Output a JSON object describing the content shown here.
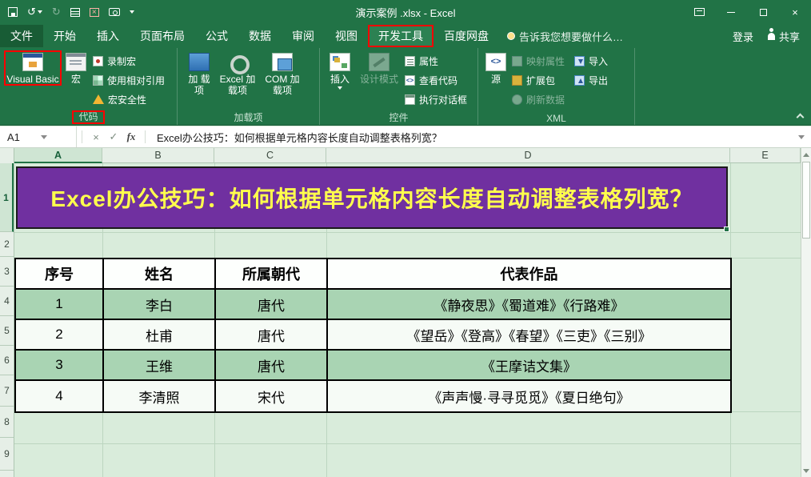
{
  "titlebar": {
    "title": "演示案例 .xlsx - Excel"
  },
  "ribbon": {
    "tabs": [
      {
        "label": "文件",
        "active": false
      },
      {
        "label": "开始",
        "active": false
      },
      {
        "label": "插入",
        "active": false
      },
      {
        "label": "页面布局",
        "active": false
      },
      {
        "label": "公式",
        "active": false
      },
      {
        "label": "数据",
        "active": false
      },
      {
        "label": "审阅",
        "active": false
      },
      {
        "label": "视图",
        "active": false
      },
      {
        "label": "开发工具",
        "active": true
      },
      {
        "label": "百度网盘",
        "active": false
      }
    ],
    "tell_me": "告诉我您想要做什么…",
    "login": "登录",
    "share": "共享",
    "code_group": {
      "label": "代码",
      "visual_basic": "Visual Basic",
      "macros": "宏",
      "record_macro": "录制宏",
      "use_relative_references": "使用相对引用",
      "macro_security": "宏安全性"
    },
    "addins_group": {
      "label": "加载项",
      "addins": "加 载项",
      "excel_addins": "Excel 加载项",
      "com_addins": "COM 加载项"
    },
    "controls_group": {
      "label": "控件",
      "insert": "插入",
      "design_mode": "设计模式",
      "properties": "属性",
      "view_code": "查看代码",
      "run_dialog": "执行对话框"
    },
    "xml_group": {
      "label": "XML",
      "source": "源",
      "map_properties": "映射属性",
      "expansion_packs": "扩展包",
      "refresh_data": "刷新数据",
      "import": "导入",
      "export": "导出"
    }
  },
  "formula_bar": {
    "cell_ref": "A1",
    "formula": "Excel办公技巧：如何根据单元格内容长度自动调整表格列宽？"
  },
  "sheet": {
    "column_headers": [
      "A",
      "B",
      "C",
      "D",
      "E"
    ],
    "row_headers": [
      "1",
      "2",
      "3",
      "4",
      "5",
      "6",
      "7",
      "8",
      "9"
    ],
    "title_banner": "Excel办公技巧：如何根据单元格内容长度自动调整表格列宽？",
    "table": {
      "headers": [
        "序号",
        "姓名",
        "所属朝代",
        "代表作品"
      ],
      "rows": [
        {
          "no": "1",
          "name": "李白",
          "dynasty": "唐代",
          "works": "《静夜思》《蜀道难》《行路难》"
        },
        {
          "no": "2",
          "name": "杜甫",
          "dynasty": "唐代",
          "works": "《望岳》《登高》《春望》《三吏》《三别》"
        },
        {
          "no": "3",
          "name": "王维",
          "dynasty": "唐代",
          "works": "《王摩诘文集》"
        },
        {
          "no": "4",
          "name": "李清照",
          "dynasty": "宋代",
          "works": "《声声慢·寻寻觅觅》《夏日绝句》"
        }
      ]
    }
  },
  "colors": {
    "ribbon_green": "#217346",
    "banner_purple": "#7030a0",
    "banner_text_yellow": "#ffff4d",
    "table_row_green": "#a9d4b3",
    "sheet_background": "#d9ecdb",
    "annotation_red": "#ff0000"
  }
}
